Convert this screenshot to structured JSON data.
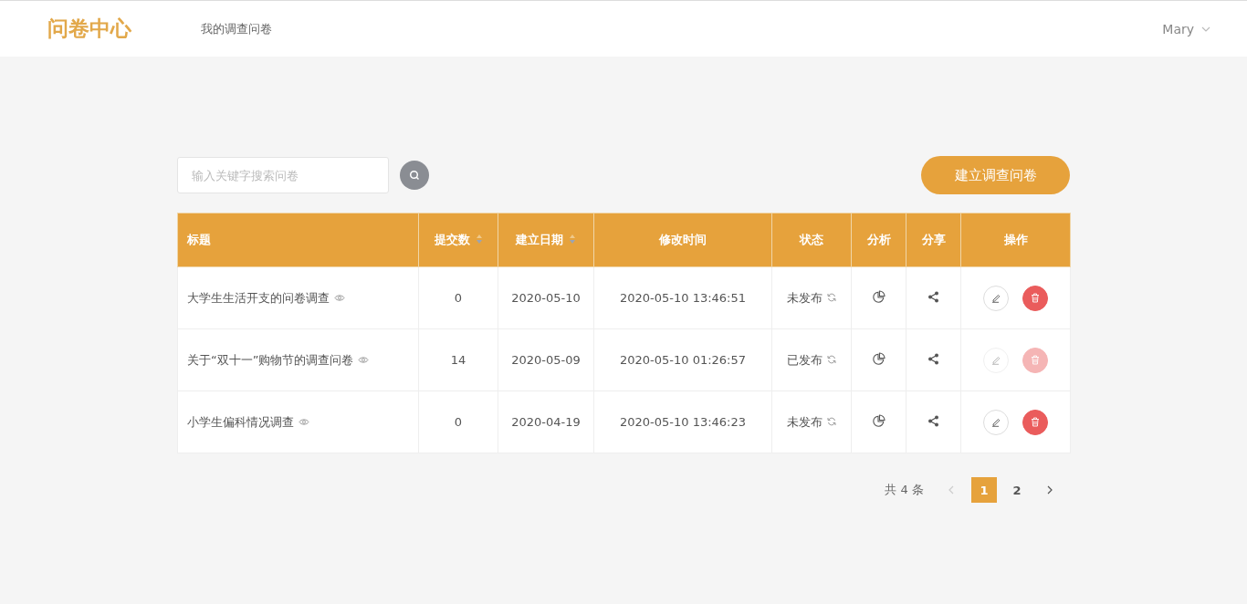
{
  "header": {
    "logo": "问卷中心",
    "nav": [
      {
        "label": "我的调查问卷",
        "selected": false
      }
    ],
    "user": "Mary"
  },
  "search": {
    "placeholder": "输入关键字搜索问卷"
  },
  "create_button": "建立调查问卷",
  "table": {
    "columns": [
      {
        "label": "标题",
        "sortable": false
      },
      {
        "label": "提交数",
        "sortable": true
      },
      {
        "label": "建立日期",
        "sortable": true
      },
      {
        "label": "修改时间",
        "sortable": false
      },
      {
        "label": "状态",
        "sortable": false
      },
      {
        "label": "分析",
        "sortable": false
      },
      {
        "label": "分享",
        "sortable": false
      },
      {
        "label": "操作",
        "sortable": false
      }
    ],
    "rows": [
      {
        "title": "大学生生活开支的问卷调查",
        "submissions": "0",
        "created": "2020-05-10",
        "modified": "2020-05-10 13:46:51",
        "status": "未发布",
        "disabled": false
      },
      {
        "title": "关于“双十一”购物节的调查问卷",
        "submissions": "14",
        "created": "2020-05-09",
        "modified": "2020-05-10 01:26:57",
        "status": "已发布",
        "disabled": true
      },
      {
        "title": "小学生偏科情况调查",
        "submissions": "0",
        "created": "2020-04-19",
        "modified": "2020-05-10 13:46:23",
        "status": "未发布",
        "disabled": false
      }
    ]
  },
  "pagination": {
    "total": "共 4 条",
    "prev_disabled": true,
    "next_disabled": false,
    "pages": [
      {
        "label": "1",
        "selected": true
      },
      {
        "label": "2",
        "selected": false
      }
    ]
  }
}
